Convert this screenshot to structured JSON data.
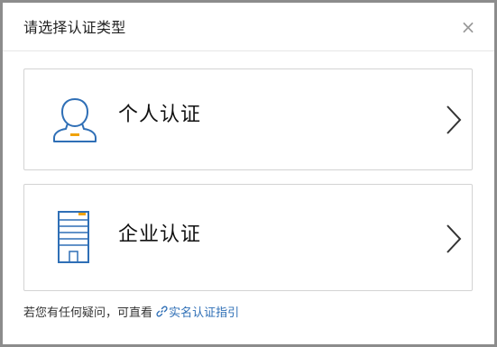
{
  "dialog": {
    "title": "请选择认证类型",
    "close_glyph": "×"
  },
  "options": [
    {
      "label": "个人认证",
      "icon": "person-icon"
    },
    {
      "label": "企业认证",
      "icon": "building-icon"
    }
  ],
  "footer": {
    "text": "若您有任何疑问，可直看",
    "link_label": "实名认证指引",
    "link_icon": "link-icon"
  },
  "colors": {
    "icon_blue": "#2f6fb6",
    "icon_orange": "#f0a30a",
    "link_blue": "#2f6fb6"
  }
}
